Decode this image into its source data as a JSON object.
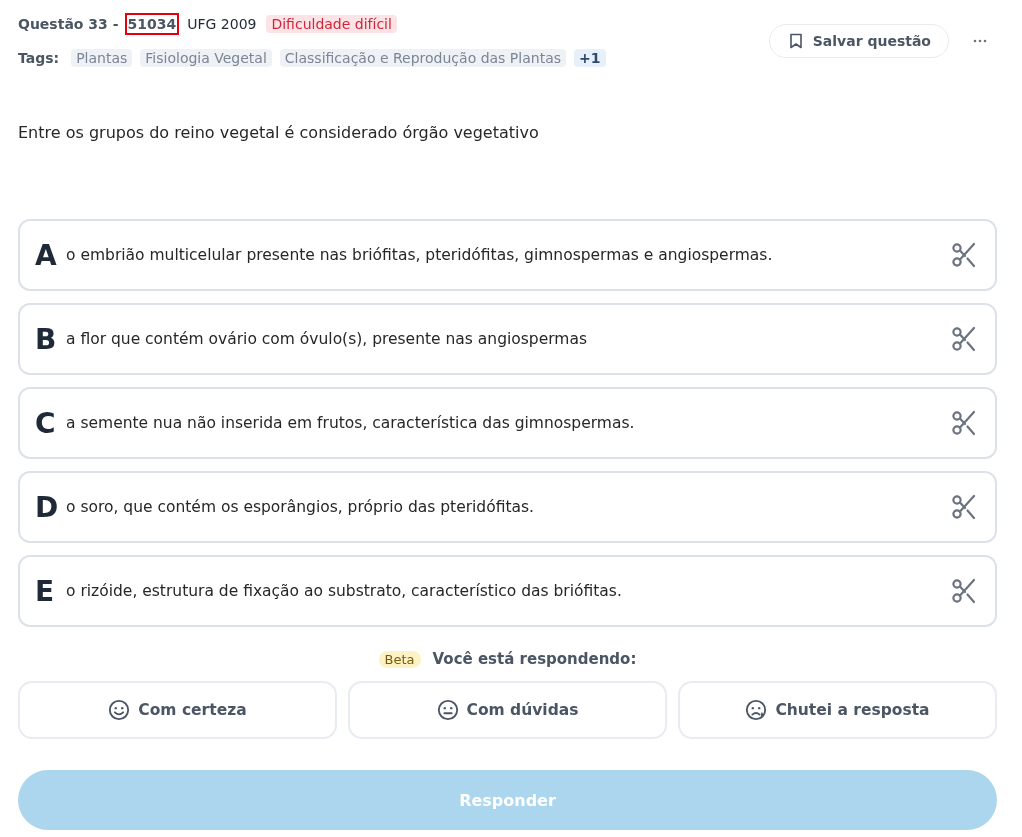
{
  "question": {
    "number_label": "Questão 33 -",
    "id": "51034",
    "id_highlighted": true,
    "source": "UFG 2009",
    "difficulty": "Dificuldade difícil"
  },
  "tags": {
    "label": "Tags:",
    "items": [
      {
        "text": "Plantas",
        "kind": "tag"
      },
      {
        "text": "Fisiologia Vegetal",
        "kind": "tag"
      },
      {
        "text": "Classificação e Reprodução das Plantas",
        "kind": "tag"
      },
      {
        "text": "+1",
        "kind": "more"
      }
    ]
  },
  "save_button": {
    "label": "Salvar questão"
  },
  "statement": "Entre os grupos do reino vegetal é considerado órgão vegetativo",
  "options": [
    {
      "letter": "A",
      "text": "o embrião multicelular presente nas briófitas, pteridófitas, gimnospermas e angiospermas."
    },
    {
      "letter": "B",
      "text": "a flor que contém ovário com óvulo(s), presente nas angiospermas"
    },
    {
      "letter": "C",
      "text": "a semente nua não inserida em frutos, característica das gimnospermas."
    },
    {
      "letter": "D",
      "text": "o soro, que contém os esporângios, próprio das pteridófitas."
    },
    {
      "letter": "E",
      "text": "o rizóide, estrutura de fixação ao substrato, característico das briófitas."
    }
  ],
  "confidence": {
    "badge": "Beta",
    "prompt": "Você está respondendo:",
    "choices": [
      {
        "label": "Com certeza",
        "kind": "sure",
        "selected": false
      },
      {
        "label": "Com dúvidas",
        "kind": "doubt",
        "selected": false
      },
      {
        "label": "Chutei a resposta",
        "kind": "guess",
        "selected": false
      }
    ]
  },
  "submit": {
    "label": "Responder",
    "disabled": true
  }
}
